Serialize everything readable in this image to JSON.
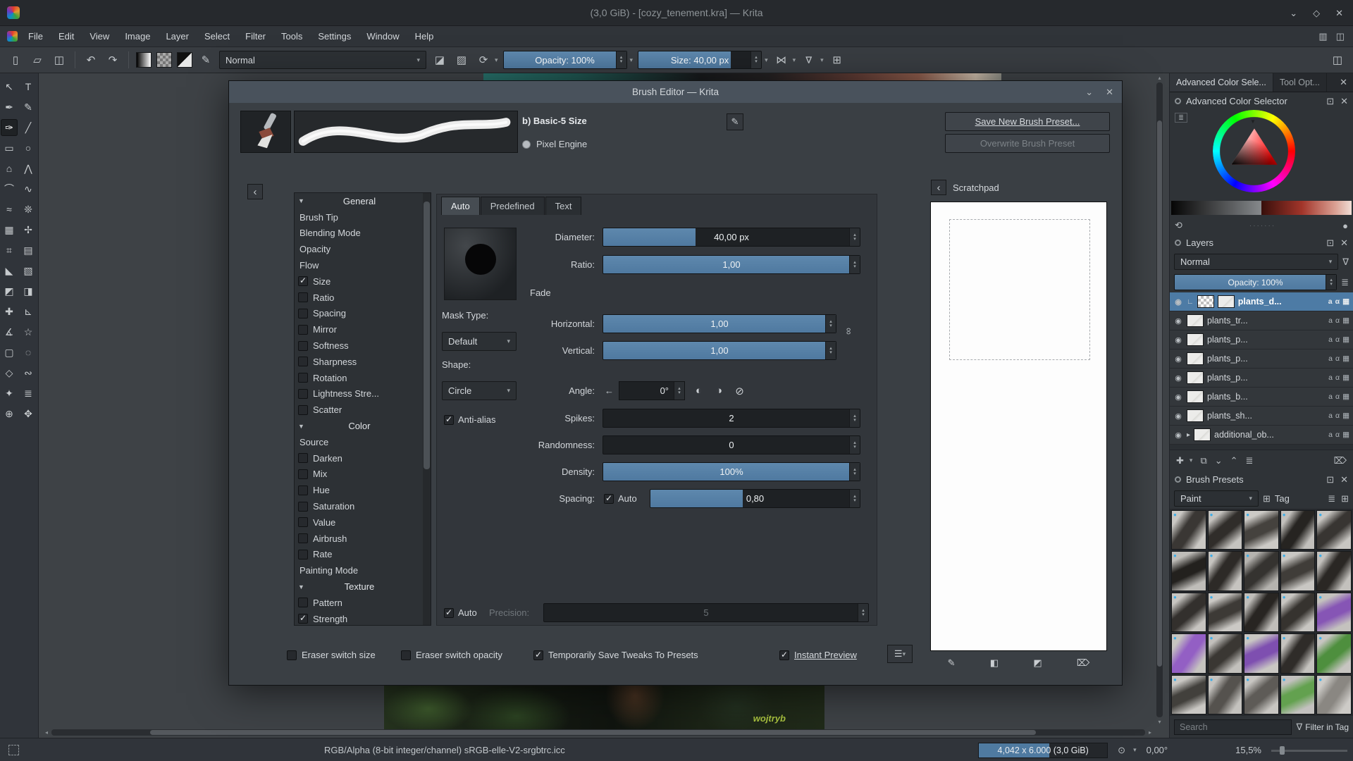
{
  "colors": {
    "accent": "#3daee9",
    "slider_fill": "#5681a7",
    "selection": "#4d7ba5"
  },
  "icons": {
    "newdoc": "▯",
    "open": "▱",
    "save": "◫",
    "undo": "↶",
    "redo": "↷",
    "brush_editor": "✎",
    "eraser": "◪",
    "alpha": "▨",
    "reload": "⟳",
    "mirror": "⋈",
    "mirror_v": "⊳",
    "trim": "⊞",
    "workspace": "◫",
    "panels": "▥",
    "dropdown": "▾",
    "sup": "▴",
    "sdown": "▾",
    "sleft": "◂",
    "sright": "▸",
    "shade": "⌄",
    "maximize": "◇",
    "close": "✕",
    "menu": "☰",
    "float": "⊡",
    "eye": "◉",
    "grid": "▦",
    "caret": "▸",
    "tri": "▼",
    "grip": "·······",
    "plus": "✚",
    "dup": "⧉",
    "arrdown": "⌄",
    "arrup": "⌃",
    "props": "≣",
    "trash": "⌦",
    "pen": "✎",
    "gradsq": "◧",
    "fillsq": "◩",
    "funnel": "∇",
    "tagic": "⊞",
    "listview": "≣",
    "gridview": "⊞",
    "refresh": "⟲",
    "left": "‹",
    "link": "∞",
    "reset_arrow": "←",
    "angle1": "◐",
    "angle2": "◑",
    "angle3": "⊘",
    "rotate": "⊙",
    "droplet": "●"
  },
  "window": {
    "title": "(3,0 GiB) - [cozy_tenement.kra] — Krita"
  },
  "menu": {
    "items": [
      "File",
      "Edit",
      "View",
      "Image",
      "Layer",
      "Select",
      "Filter",
      "Tools",
      "Settings",
      "Window",
      "Help"
    ]
  },
  "toolbar": {
    "blending_mode": "Normal",
    "opacity_label": "Opacity: 100%",
    "opacity_fill": 100,
    "size_label": "Size: 40,00 px",
    "size_fill": 75
  },
  "toolbox": {
    "tools": [
      {
        "name": "shape-select",
        "glyph": "↖"
      },
      {
        "name": "text",
        "glyph": "T"
      },
      {
        "name": "edit-shapes",
        "glyph": "✒"
      },
      {
        "name": "calligraphy",
        "glyph": "✎"
      },
      {
        "name": "freehand-brush",
        "glyph": "✑",
        "selected": true
      },
      {
        "name": "line",
        "glyph": "╱"
      },
      {
        "name": "rectangle",
        "glyph": "▭"
      },
      {
        "name": "ellipse",
        "glyph": "○"
      },
      {
        "name": "polygon",
        "glyph": "⌂"
      },
      {
        "name": "polyline",
        "glyph": "⋀"
      },
      {
        "name": "bezier-curve",
        "glyph": "⌒"
      },
      {
        "name": "freehand-path",
        "glyph": "∿"
      },
      {
        "name": "dynamic-brush",
        "glyph": "≈"
      },
      {
        "name": "multibrush",
        "glyph": "❊"
      },
      {
        "name": "transform",
        "glyph": "▦"
      },
      {
        "name": "move",
        "glyph": "✢"
      },
      {
        "name": "crop",
        "glyph": "⌗"
      },
      {
        "name": "gradient",
        "glyph": "▤"
      },
      {
        "name": "color-sampler",
        "glyph": "◣"
      },
      {
        "name": "pattern-edit",
        "glyph": "▧"
      },
      {
        "name": "fill",
        "glyph": "◩"
      },
      {
        "name": "enclose-fill",
        "glyph": "◨"
      },
      {
        "name": "smart-patch",
        "glyph": "✚"
      },
      {
        "name": "assistants",
        "glyph": "⊾"
      },
      {
        "name": "measure",
        "glyph": "∡"
      },
      {
        "name": "reference-images",
        "glyph": "☆"
      },
      {
        "name": "rect-select",
        "glyph": "▢"
      },
      {
        "name": "ellipse-select",
        "glyph": "◌"
      },
      {
        "name": "polygon-select",
        "glyph": "◇"
      },
      {
        "name": "freehand-select",
        "glyph": "∾"
      },
      {
        "name": "contiguous-select",
        "glyph": "✦"
      },
      {
        "name": "similar-select",
        "glyph": "≣"
      },
      {
        "name": "zoom",
        "glyph": "⊕"
      },
      {
        "name": "pan",
        "glyph": "✥"
      }
    ]
  },
  "canvas": {
    "watermark": "wojtryb"
  },
  "dialog": {
    "title": "Brush Editor — Krita",
    "preset_name": "b) Basic-5 Size",
    "engine": "Pixel Engine",
    "save_new": "Save New Brush Preset...",
    "overwrite": "Overwrite Brush Preset",
    "scratchpad_title": "Scratchpad",
    "tabs": [
      "Auto",
      "Predefined",
      "Text"
    ],
    "options": [
      {
        "t": "h",
        "l": "General"
      },
      {
        "t": "p",
        "l": "Brush Tip"
      },
      {
        "t": "p",
        "l": "Blending Mode"
      },
      {
        "t": "p",
        "l": "Opacity"
      },
      {
        "t": "p",
        "l": "Flow"
      },
      {
        "t": "c",
        "l": "Size",
        "ck": 1
      },
      {
        "t": "c",
        "l": "Ratio"
      },
      {
        "t": "c",
        "l": "Spacing"
      },
      {
        "t": "c",
        "l": "Mirror"
      },
      {
        "t": "c",
        "l": "Softness"
      },
      {
        "t": "c",
        "l": "Sharpness"
      },
      {
        "t": "c",
        "l": "Rotation"
      },
      {
        "t": "c",
        "l": "Lightness Stre..."
      },
      {
        "t": "c",
        "l": "Scatter"
      },
      {
        "t": "h",
        "l": "Color"
      },
      {
        "t": "p",
        "l": "Source"
      },
      {
        "t": "c",
        "l": "Darken"
      },
      {
        "t": "c",
        "l": "Mix"
      },
      {
        "t": "c",
        "l": "Hue"
      },
      {
        "t": "c",
        "l": "Saturation"
      },
      {
        "t": "c",
        "l": "Value"
      },
      {
        "t": "c",
        "l": "Airbrush"
      },
      {
        "t": "c",
        "l": "Rate"
      },
      {
        "t": "p",
        "l": "Painting Mode"
      },
      {
        "t": "h",
        "l": "Texture"
      },
      {
        "t": "c",
        "l": "Pattern"
      },
      {
        "t": "c",
        "l": "Strength",
        "ck": 1
      }
    ],
    "params": {
      "diameter_label": "Diameter:",
      "diameter_value": "40,00 px",
      "diameter_fill": 36,
      "ratio_label": "Ratio:",
      "ratio_value": "1,00",
      "ratio_fill": 100,
      "fade_label": "Fade",
      "horizontal_label": "Horizontal:",
      "horizontal_value": "1,00",
      "horizontal_fill": 100,
      "vertical_label": "Vertical:",
      "vertical_value": "1,00",
      "vertical_fill": 100,
      "mask_type_label": "Mask Type:",
      "mask_type_value": "Default",
      "shape_label": "Shape:",
      "shape_value": "Circle",
      "angle_label": "Angle:",
      "angle_value": "0°",
      "antialias_label": "Anti-alias",
      "spikes_label": "Spikes:",
      "spikes_value": "2",
      "spikes_fill": 0,
      "randomness_label": "Randomness:",
      "randomness_value": "0",
      "randomness_fill": 0,
      "density_label": "Density:",
      "density_value": "100%",
      "density_fill": 100,
      "spacing_label": "Spacing:",
      "spacing_auto": "Auto",
      "spacing_value": "0,80",
      "spacing_fill": 44,
      "auto_label": "Auto",
      "precision_label": "Precision:",
      "precision_value": "5",
      "precision_fill": 0
    },
    "footer": {
      "eraser_size": "Eraser switch size",
      "eraser_opacity": "Eraser switch opacity",
      "tweaks": "Temporarily Save Tweaks To Presets",
      "instant": "Instant Preview"
    }
  },
  "docker": {
    "tab1": "Advanced Color Sele...",
    "tab2": "Tool Opt...",
    "acs_title": "Advanced Color Selector",
    "layers_title": "Layers",
    "layers_blend": "Normal",
    "layers_opacity": "Opacity: 100%",
    "layers_opacity_fill": 100,
    "layers": [
      {
        "name": "plants_d...",
        "selected": true,
        "indent": true,
        "checker": true
      },
      {
        "name": "plants_tr..."
      },
      {
        "name": "plants_p..."
      },
      {
        "name": "plants_p..."
      },
      {
        "name": "plants_p..."
      },
      {
        "name": "plants_b..."
      },
      {
        "name": "plants_sh..."
      },
      {
        "name": "additional_ob...",
        "caret": true
      }
    ],
    "presets_title": "Brush Presets",
    "presets_tag": "Paint",
    "tag_label": "Tag",
    "search_placeholder": "Search",
    "filter_label": "Filter in Tag",
    "presets": [
      {
        "b": "#cac8c4",
        "s": "#3a3734"
      },
      {
        "b": "#c5c3bf",
        "s": "#302d2a"
      },
      {
        "b": "#cccac6",
        "s": "#45423e"
      },
      {
        "b": "#c2c0bc",
        "s": "#262421"
      },
      {
        "b": "#c8c6c2",
        "s": "#383532"
      },
      {
        "b": "#bfbdb9",
        "s": "#23211e"
      },
      {
        "b": "#c6c4c0",
        "s": "#2d2a27"
      },
      {
        "b": "#b5b3af",
        "s": "#353330"
      },
      {
        "b": "#c9c7c3",
        "s": "#403d39"
      },
      {
        "b": "#c3c1bd",
        "s": "#2a2724"
      },
      {
        "b": "#c7c5c1",
        "s": "#33302d"
      },
      {
        "b": "#cbc9c5",
        "s": "#3d3a36"
      },
      {
        "b": "#c0beba",
        "s": "#282522"
      },
      {
        "b": "#c8c6c2",
        "s": "#36332f"
      },
      {
        "b": "#c4c2be",
        "s": "#8655b5"
      },
      {
        "b": "#c6c4c0",
        "s": "#935fc4"
      },
      {
        "b": "#c2c0bc",
        "s": "#3a3733"
      },
      {
        "b": "#c9c7c3",
        "s": "#7e4fb0"
      },
      {
        "b": "#c5c3bf",
        "s": "#2f2c29"
      },
      {
        "b": "#c7c5c1",
        "s": "#4e8f3e"
      },
      {
        "b": "#cac8c4",
        "s": "#42403c"
      },
      {
        "b": "#c4c2be",
        "s": "#55524e"
      },
      {
        "b": "#c8c6c2",
        "s": "#5e5b57"
      },
      {
        "b": "#c3c1bf",
        "s": "#63a14f"
      },
      {
        "b": "#cdcbc7",
        "s": "#8a8782"
      }
    ]
  },
  "statusbar": {
    "profile": "RGB/Alpha (8-bit integer/channel)  sRGB-elle-V2-srgbtrc.icc",
    "size_info": "4,042 x 6.000 (3,0 GiB)",
    "memory_fill": 55,
    "angle": "0,00°",
    "zoom": "15,5%"
  }
}
